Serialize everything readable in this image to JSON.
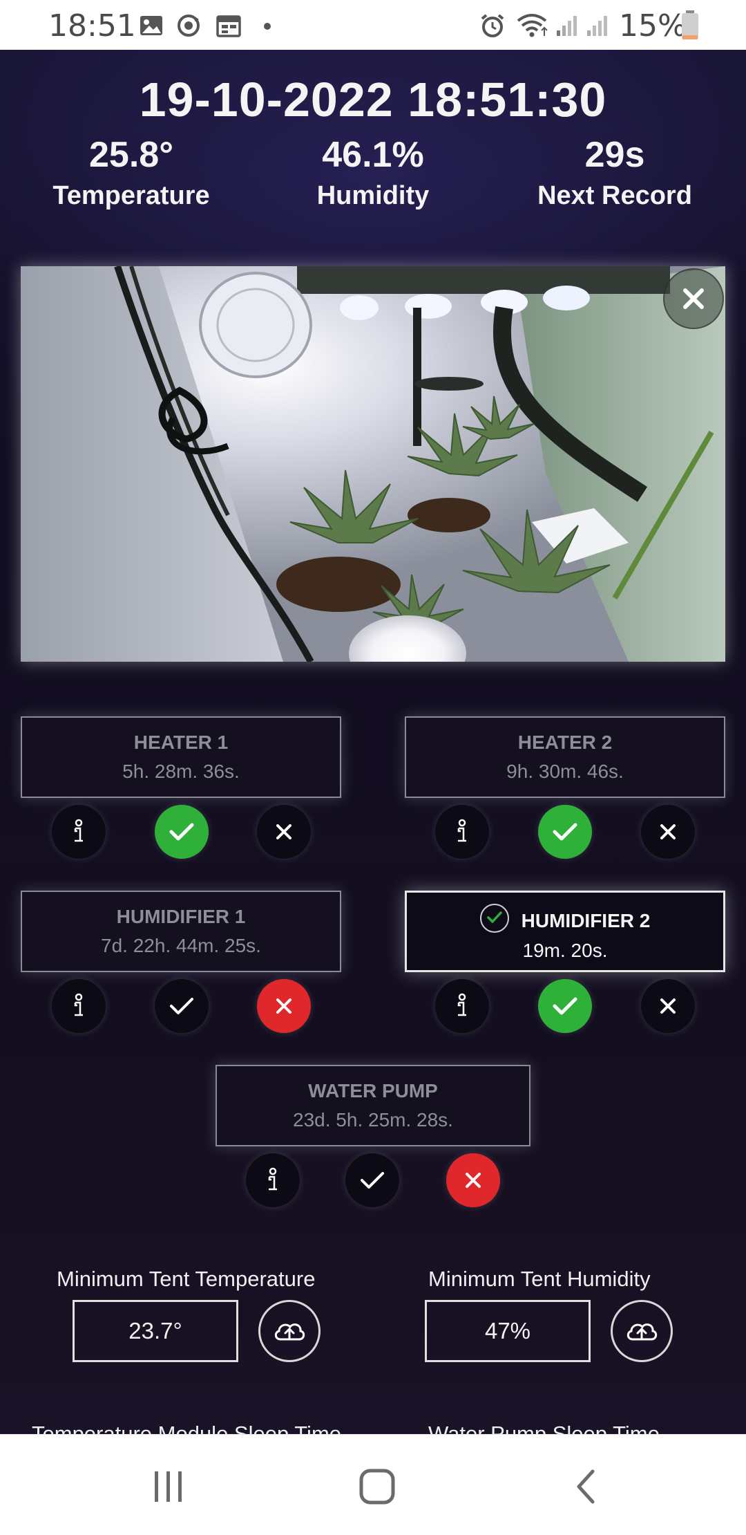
{
  "status_bar": {
    "time": "18:51",
    "battery": "15%",
    "icons": [
      "gallery-icon",
      "sync-icon",
      "calendar-icon",
      "alarm-icon",
      "wifi-icon",
      "signal-icon",
      "signal-icon",
      "battery-icon"
    ]
  },
  "header": {
    "datetime": "19-10-2022 18:51:30",
    "stats": [
      {
        "value": "25.8°",
        "label": "Temperature"
      },
      {
        "value": "46.1%",
        "label": "Humidity"
      },
      {
        "value": "29s",
        "label": "Next Record"
      }
    ]
  },
  "devices": [
    {
      "name": "HEATER 1",
      "time": "5h. 28m. 36s.",
      "state": "on"
    },
    {
      "name": "HEATER 2",
      "time": "9h. 30m. 46s.",
      "state": "on"
    },
    {
      "name": "HUMIDIFIER 1",
      "time": "7d. 22h. 44m. 25s.",
      "state": "off"
    },
    {
      "name": "HUMIDIFIER 2",
      "time": "19m. 20s.",
      "state": "on",
      "active": true
    },
    {
      "name": "WATER PUMP",
      "time": "23d. 5h. 25m. 28s.",
      "state": "off"
    }
  ],
  "settings": {
    "min_temp": {
      "label": "Minimum Tent Temperature",
      "value": "23.7°"
    },
    "min_humidity": {
      "label": "Minimum Tent Humidity",
      "value": "47%"
    },
    "temp_sleep": {
      "label": "Temperature Module Sleep Time"
    },
    "pump_sleep": {
      "label": "Water Pump Sleep Time"
    }
  },
  "colors": {
    "on_green": "#2fb039",
    "off_red": "#e0282c",
    "background": "#130f24"
  }
}
